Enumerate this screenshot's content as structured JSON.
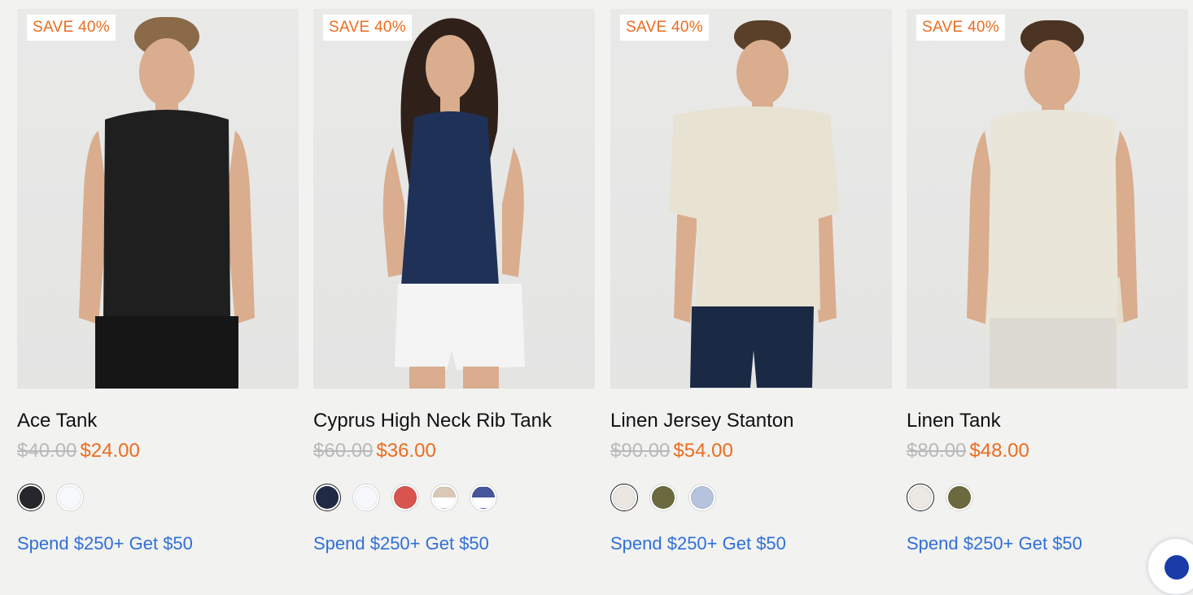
{
  "products": [
    {
      "badge": "SAVE 40%",
      "title": "Ace Tank",
      "old_price": "$40.00",
      "new_price": "$24.00",
      "promo": "Spend $250+ Get $50",
      "hair": "#8a6a48",
      "top": "#1f1f20",
      "bottom": "#161616",
      "swatches": [
        {
          "name": "black",
          "color": "#26272a",
          "selected": true
        },
        {
          "name": "white",
          "color": "#f7f9fc",
          "selected": false
        }
      ]
    },
    {
      "badge": "SAVE 40%",
      "title": "Cyprus High Neck Rib Tank",
      "old_price": "$60.00",
      "new_price": "$36.00",
      "promo": "Spend $250+ Get $50",
      "hair": "#2f211a",
      "top": "#1f3157",
      "bottom": "#f4f4f4",
      "swatches": [
        {
          "name": "navy",
          "color": "#1f2a44",
          "selected": true
        },
        {
          "name": "white",
          "color": "#f6f8fc",
          "selected": false
        },
        {
          "name": "red",
          "color": "#d9544f",
          "selected": false
        },
        {
          "name": "sand-white",
          "color": "#d9c8b6",
          "color2": "#ffffff",
          "selected": false
        },
        {
          "name": "blue-white",
          "color": "#45569b",
          "color2": "#ffffff",
          "selected": false
        }
      ]
    },
    {
      "badge": "SAVE 40%",
      "title": "Linen Jersey Stanton",
      "old_price": "$90.00",
      "new_price": "$54.00",
      "promo": "Spend $250+ Get $50",
      "hair": "#5a4028",
      "top": "#e8e2d3",
      "bottom": "#1b2a44",
      "swatches": [
        {
          "name": "oatmeal",
          "color": "#ece6e2",
          "selected": true
        },
        {
          "name": "olive",
          "color": "#6b6a3f",
          "selected": false
        },
        {
          "name": "light-blue",
          "color": "#b6c3dc",
          "selected": false
        }
      ]
    },
    {
      "badge": "SAVE 40%",
      "title": "Linen Tank",
      "old_price": "$80.00",
      "new_price": "$48.00",
      "promo": "Spend $250+ Get $50",
      "hair": "#4a3322",
      "top": "#e9e5d8",
      "bottom": "#dcdad3",
      "swatches": [
        {
          "name": "oatmeal",
          "color": "#ece8e4",
          "selected": true
        },
        {
          "name": "olive",
          "color": "#6b6a3f",
          "selected": false
        }
      ]
    }
  ],
  "colors": {
    "accent": "#ea6d1f",
    "link": "#2f6fd8",
    "old_price": "#b9b9b9",
    "background": "#f2f2f1"
  },
  "chat_icon": "chat-bubble-icon"
}
